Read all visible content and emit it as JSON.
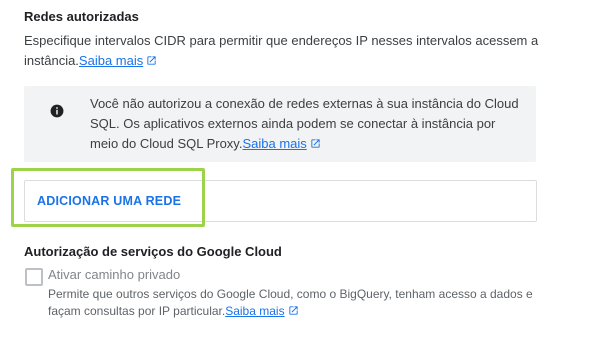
{
  "authorized_networks": {
    "title": "Redes autorizadas",
    "description": "Especifique intervalos CIDR para permitir que endereços IP nesses intervalos acessem a instância.",
    "learn_more": "Saiba mais"
  },
  "info_banner": {
    "icon": "info-icon",
    "text": "Você não autorizou a conexão de redes externas à sua instância do Cloud SQL. Os aplicativos externos ainda podem se conectar à instância por meio do Cloud SQL Proxy.",
    "learn_more": "Saiba mais"
  },
  "add_network": {
    "label": "ADICIONAR UMA REDE"
  },
  "google_services": {
    "title": "Autorização de serviços do Google Cloud",
    "private_path": {
      "label": "Ativar caminho privado",
      "checked": false,
      "help": "Permite que outros serviços do Google Cloud, como o BigQuery, tenham acesso a dados e façam consultas por IP particular.",
      "learn_more": "Saiba mais"
    }
  },
  "colors": {
    "accent": "#1a73e8",
    "highlight": "#9cd34a",
    "banner_bg": "#f1f3f4"
  }
}
